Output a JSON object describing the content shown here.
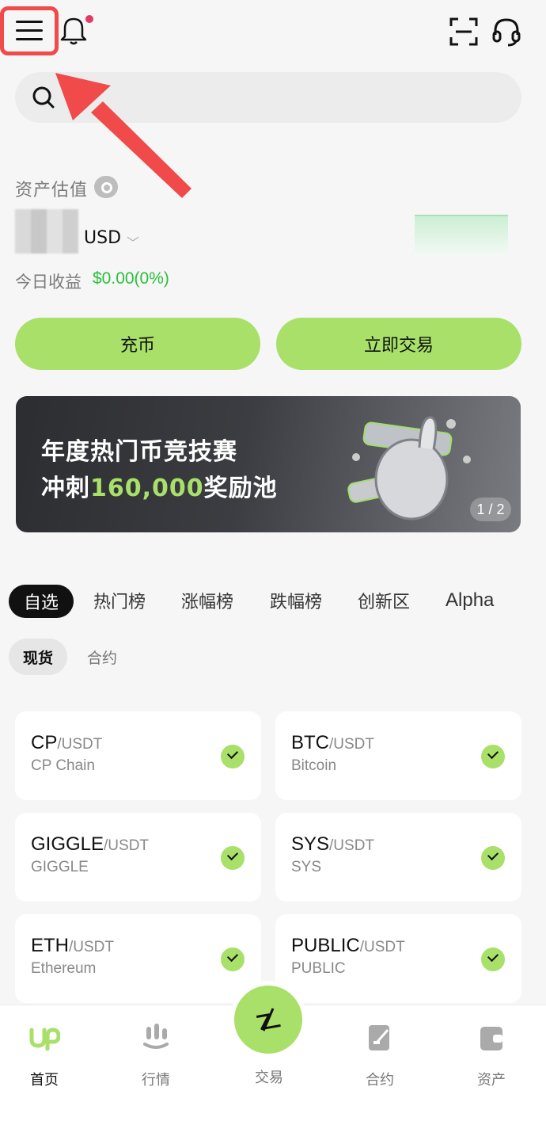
{
  "header": {
    "menu_icon": "hamburger-menu-icon",
    "bell_icon": "bell-icon",
    "scan_icon": "scan-icon",
    "support_icon": "headset-icon"
  },
  "search": {
    "placeholder": ""
  },
  "assets": {
    "label": "资产估值",
    "currency": "USD",
    "pnl_label": "今日收益",
    "pnl_value": "$0.00(0%)"
  },
  "actions": {
    "deposit": "充币",
    "trade": "立即交易"
  },
  "banner": {
    "line1": "年度热门币竞技赛",
    "line2_prefix": "冲刺",
    "line2_highlight": "160,000",
    "line2_suffix": "奖励池",
    "page_indicator": "1 / 2"
  },
  "tabs": [
    "自选",
    "热门榜",
    "涨幅榜",
    "跌幅榜",
    "创新区",
    "Alpha"
  ],
  "subtabs": [
    "现货",
    "合约"
  ],
  "watchlist": [
    {
      "base": "CP",
      "quote": "/USDT",
      "name": "CP Chain"
    },
    {
      "base": "BTC",
      "quote": "/USDT",
      "name": "Bitcoin"
    },
    {
      "base": "GIGGLE",
      "quote": "/USDT",
      "name": "GIGGLE"
    },
    {
      "base": "SYS",
      "quote": "/USDT",
      "name": "SYS"
    },
    {
      "base": "ETH",
      "quote": "/USDT",
      "name": "Ethereum"
    },
    {
      "base": "PUBLIC",
      "quote": "/USDT",
      "name": "PUBLIC"
    }
  ],
  "nav": {
    "home": "首页",
    "market": "行情",
    "trade": "交易",
    "futures": "合约",
    "assets": "资产"
  },
  "colors": {
    "accent": "#a8e06a",
    "positive": "#2bbf3a",
    "highlight_border": "#f04a4a"
  }
}
